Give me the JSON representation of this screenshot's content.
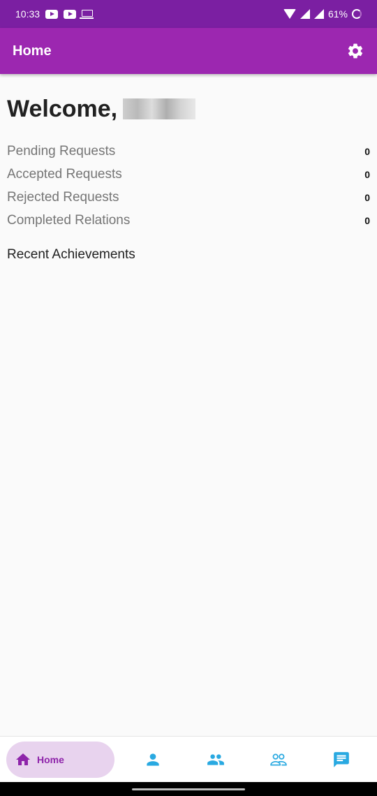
{
  "status_bar": {
    "time": "10:33",
    "battery": "61%"
  },
  "app_bar": {
    "title": "Home"
  },
  "welcome": {
    "text": "Welcome,"
  },
  "stats": [
    {
      "label": "Pending Requests",
      "value": "0"
    },
    {
      "label": "Accepted Requests",
      "value": "0"
    },
    {
      "label": "Rejected Requests",
      "value": "0"
    },
    {
      "label": "Completed Relations",
      "value": "0"
    }
  ],
  "section_title": "Recent Achievements",
  "bottom_nav": {
    "home_label": "Home",
    "items": [
      "home-icon",
      "person-icon",
      "people-icon",
      "people-outline-icon",
      "chat-icon"
    ]
  },
  "colors": {
    "status_bar": "#7b1fa2",
    "app_bar": "#9c27b0",
    "nav_active": "#8e24aa",
    "nav_inactive": "#29a9e1"
  }
}
